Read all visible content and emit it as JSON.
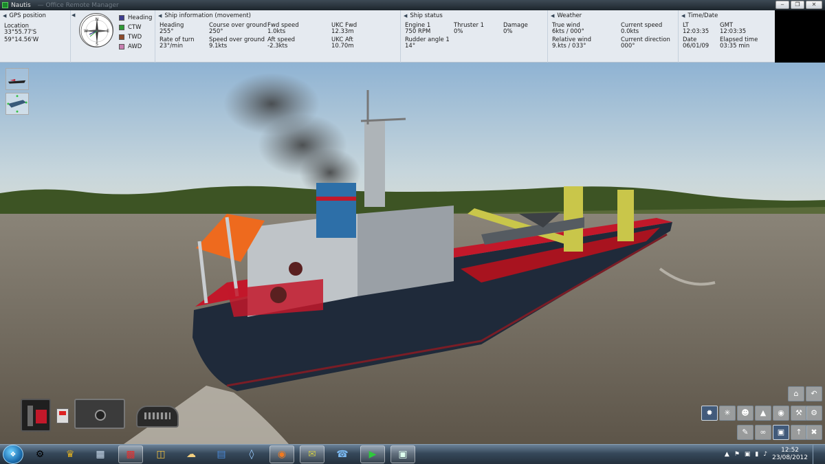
{
  "window": {
    "title": "Nautis",
    "subtitle": "— Office Remote Manager",
    "controls": [
      "‒",
      "❐",
      "✕"
    ]
  },
  "gps": {
    "header": "GPS position",
    "location_label": "Location",
    "lat": "33°55.77'S",
    "lon": "59°14.56'W"
  },
  "compass": {
    "marks": [
      "N",
      "E",
      "S",
      "W"
    ]
  },
  "legend": [
    {
      "label": "Heading",
      "color": "#3d3d8f"
    },
    {
      "label": "CTW",
      "color": "#2e9a36"
    },
    {
      "label": "TWD",
      "color": "#8c4a2a"
    },
    {
      "label": "AWD",
      "color": "#c77fb0"
    }
  ],
  "movement": {
    "header": "Ship information (movement)",
    "heading_label": "Heading",
    "heading": "255°",
    "rot_label": "Rate of turn",
    "rot": "23°/min",
    "cog_label": "Course over ground",
    "cog": "250°",
    "sog_label": "Speed over ground",
    "sog": "9.1kts",
    "fwd_label": "Fwd speed",
    "fwd": "1.0kts",
    "aft_label": "Aft speed",
    "aft": "-2.3kts",
    "ukc_fwd_label": "UKC Fwd",
    "ukc_fwd": "12.33m",
    "ukc_aft_label": "UKC Aft",
    "ukc_aft": "10.70m"
  },
  "status": {
    "header": "Ship status",
    "engine_label": "Engine 1",
    "engine": "750 RPM",
    "rudder_label": "Rudder angle 1",
    "rudder": "14°",
    "thruster_label": "Thruster 1",
    "thruster": "0%",
    "damage_label": "Damage",
    "damage": "0%"
  },
  "weather": {
    "header": "Weather",
    "true_wind_label": "True wind",
    "true_wind": "6kts / 000°",
    "rel_wind_label": "Relative wind",
    "rel_wind": "9.kts / 033°",
    "cur_speed_label": "Current speed",
    "cur_speed": "0.0kts",
    "cur_dir_label": "Current direction",
    "cur_dir": "000°"
  },
  "time": {
    "header": "Time/Date",
    "lt_label": "LT",
    "lt": "12:03:35",
    "gmt_label": "GMT",
    "gmt": "12:03:35",
    "date_label": "Date",
    "date": "06/01/09",
    "elapsed_label": "Elapsed time",
    "elapsed": "03:35 min"
  },
  "colors": {
    "sea": "#6d6558",
    "hull": "#1f2a3a",
    "deck": "#c2182a",
    "crane": "#c9c64a",
    "lifeboat": "#ee6a1e"
  },
  "taskbar": {
    "apps": [
      "settings-icon",
      "badge-icon",
      "calculator-icon",
      "paint-icon",
      "folder-icon",
      "cloud-icon",
      "word-icon",
      "window-icon",
      "firefox-icon",
      "chat-icon",
      "mail-icon",
      "player-icon",
      "app-icon"
    ],
    "clock_time": "12:52",
    "clock_date": "23/08/2012"
  }
}
